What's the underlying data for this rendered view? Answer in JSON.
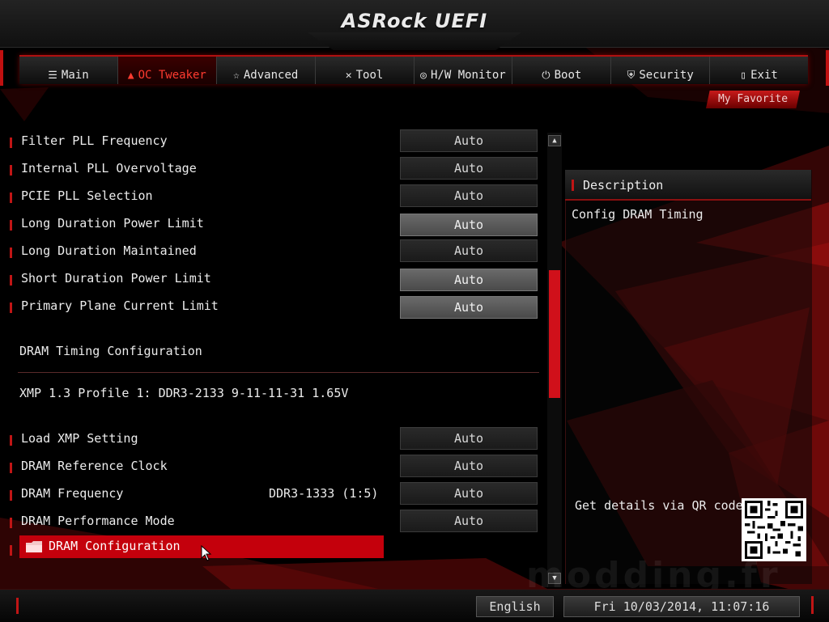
{
  "header": {
    "logo": "ASRock UEFI"
  },
  "nav": [
    {
      "label": "Main",
      "icon": "list-icon",
      "glyph": "☰",
      "active": false
    },
    {
      "label": "OC Tweaker",
      "icon": "flame-icon",
      "glyph": "🔥",
      "active": true
    },
    {
      "label": "Advanced",
      "icon": "star-icon",
      "glyph": "☆",
      "active": false
    },
    {
      "label": "Tool",
      "icon": "tools-icon",
      "glyph": "✕",
      "active": false
    },
    {
      "label": "H/W Monitor",
      "icon": "monitor-icon",
      "glyph": "◎",
      "active": false
    },
    {
      "label": "Boot",
      "icon": "power-icon",
      "glyph": "⏻",
      "active": false
    },
    {
      "label": "Security",
      "icon": "shield-icon",
      "glyph": "⛨",
      "active": false
    },
    {
      "label": "Exit",
      "icon": "exit-icon",
      "glyph": "▯",
      "active": false
    }
  ],
  "favorite": "My Favorite",
  "settings": [
    {
      "label": "Filter PLL Frequency",
      "value": "Auto",
      "highlight": false
    },
    {
      "label": "Internal PLL Overvoltage",
      "value": "Auto",
      "highlight": false
    },
    {
      "label": "PCIE PLL Selection",
      "value": "Auto",
      "highlight": false
    },
    {
      "label": "Long Duration Power Limit",
      "value": "Auto",
      "highlight": true
    },
    {
      "label": "Long Duration Maintained",
      "value": "Auto",
      "highlight": false
    },
    {
      "label": "Short Duration Power Limit",
      "value": "Auto",
      "highlight": true
    },
    {
      "label": "Primary Plane Current Limit",
      "value": "Auto",
      "highlight": true
    }
  ],
  "dram_section": "DRAM Timing Configuration",
  "xmp_info": "XMP 1.3 Profile 1: DDR3-2133 9-11-11-31 1.65V",
  "dram_settings": [
    {
      "label": "Load XMP Setting",
      "extra": "",
      "value": "Auto"
    },
    {
      "label": "DRAM Reference Clock",
      "extra": "",
      "value": "Auto"
    },
    {
      "label": "DRAM Frequency",
      "extra": "DDR3-1333 (1:5)",
      "value": "Auto"
    },
    {
      "label": "DRAM Performance Mode",
      "extra": "",
      "value": "Auto"
    }
  ],
  "selected_item": "DRAM Configuration",
  "description": {
    "title": "Description",
    "text": "Config DRAM Timing",
    "qr_text": "Get details via QR code"
  },
  "footer": {
    "language": "English",
    "datetime": "Fri 10/03/2014, 11:07:16"
  },
  "watermark": "modding.fr",
  "colors": {
    "accent": "#c4000c",
    "bg": "#000000"
  }
}
